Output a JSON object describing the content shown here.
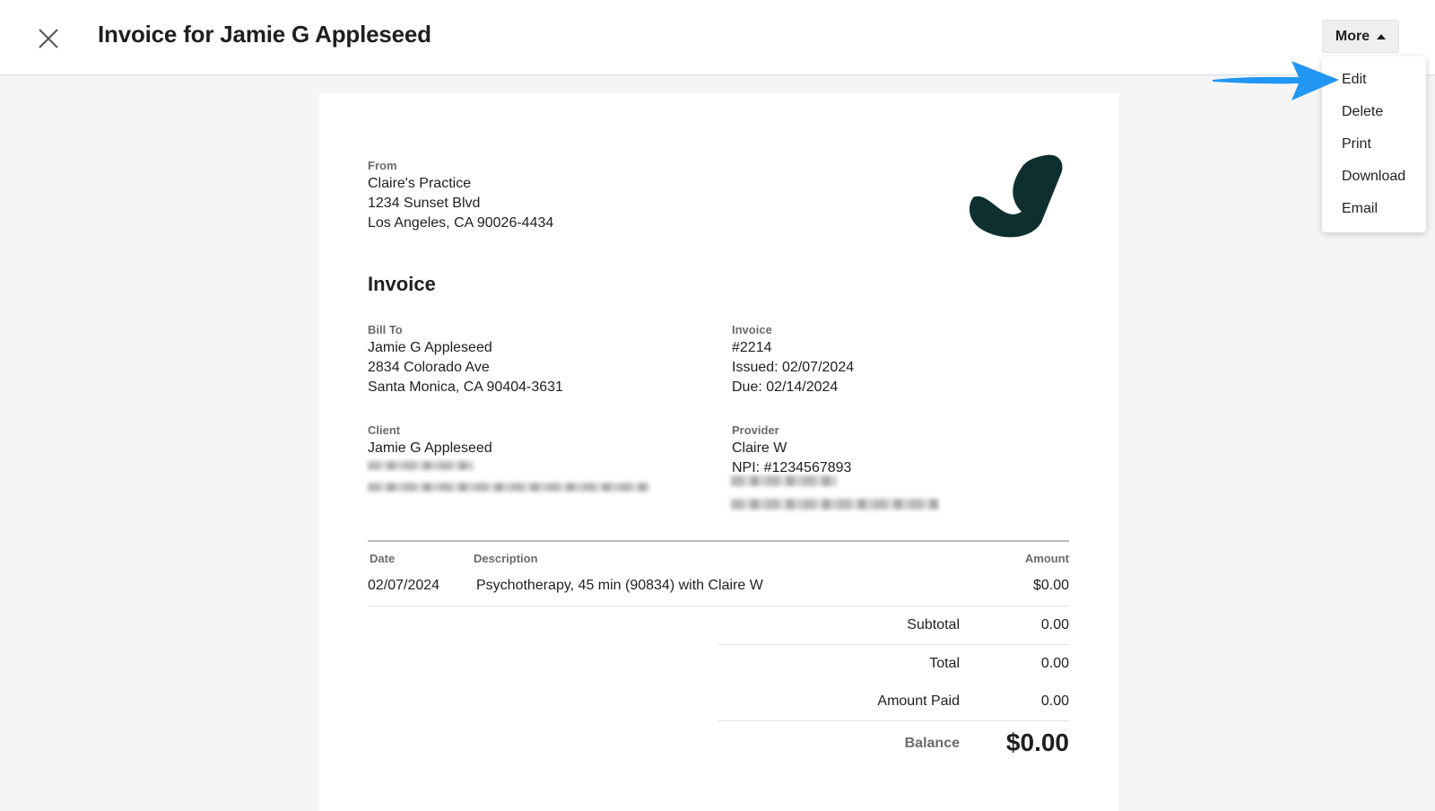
{
  "header": {
    "title": "Invoice for Jamie G Appleseed",
    "close_icon": "close-icon",
    "more_label": "More",
    "more_icon": "caret-up-icon"
  },
  "more_menu": {
    "items": [
      {
        "label": "Edit"
      },
      {
        "label": "Delete"
      },
      {
        "label": "Print"
      },
      {
        "label": "Download"
      },
      {
        "label": "Email"
      }
    ]
  },
  "annotation": {
    "arrow_icon": "pointer-arrow-icon",
    "color": "#2196f3"
  },
  "invoice": {
    "logo_color": "#0f2f2f",
    "from": {
      "label": "From",
      "name": "Claire's Practice",
      "address1": "1234 Sunset Blvd",
      "address2": "Los Angeles, CA 90026-4434"
    },
    "heading": "Invoice",
    "bill_to": {
      "label": "Bill To",
      "name": "Jamie G Appleseed",
      "address1": "2834 Colorado Ave",
      "address2": "Santa Monica, CA 90404-3631"
    },
    "details": {
      "label": "Invoice",
      "number": "#2214",
      "issued": "Issued: 02/07/2024",
      "due": "Due: 02/14/2024"
    },
    "client": {
      "label": "Client",
      "name": "Jamie G Appleseed"
    },
    "provider": {
      "label": "Provider",
      "name": "Claire W",
      "npi": "NPI: #1234567893"
    },
    "table": {
      "headers": {
        "date": "Date",
        "description": "Description",
        "amount": "Amount"
      },
      "rows": [
        {
          "date": "02/07/2024",
          "description": "Psychotherapy, 45 min (90834) with Claire W",
          "amount": "$0.00"
        }
      ]
    },
    "summary": {
      "subtotal_label": "Subtotal",
      "subtotal": "0.00",
      "total_label": "Total",
      "total": "0.00",
      "paid_label": "Amount Paid",
      "paid": "0.00",
      "balance_label": "Balance",
      "balance": "$0.00"
    }
  }
}
